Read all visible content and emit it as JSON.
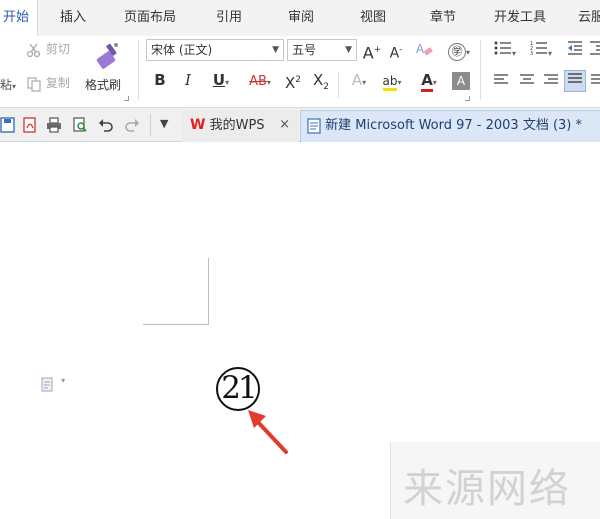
{
  "menu": {
    "tabs": [
      {
        "label": "开始",
        "active": true
      },
      {
        "label": "插入"
      },
      {
        "label": "页面布局"
      },
      {
        "label": "引用"
      },
      {
        "label": "审阅"
      },
      {
        "label": "视图"
      },
      {
        "label": "章节"
      },
      {
        "label": "开发工具"
      },
      {
        "label": "云服"
      }
    ]
  },
  "ribbon": {
    "clipboard": {
      "cut": "剪切",
      "copy": "复制",
      "format_painter": "格式刷",
      "paste_partial": "粘"
    },
    "font": {
      "family": "宋体 (正文)",
      "size": "五号",
      "grow": "A",
      "shrink": "A",
      "bold": "B",
      "italic": "I",
      "underline": "U",
      "strike": "AB",
      "superscript": "X",
      "superscript_mark": "2",
      "subscript": "X",
      "subscript_mark": "2",
      "phonetic": "㊫",
      "font_color": "A",
      "char_shading": "A",
      "effects": "A",
      "highlight": "ab"
    },
    "accent_color": "#2a5aa8"
  },
  "tabbar": {
    "tabs": [
      {
        "label": "我的WPS",
        "close": "×"
      },
      {
        "label": "新建 Microsoft Word 97 - 2003 文档 (3) *"
      }
    ],
    "active_tab_color": "#dbe7f7"
  },
  "document": {
    "circled_number": "21",
    "watermark": "来源网络",
    "arrow_color": "#e23b2e"
  }
}
